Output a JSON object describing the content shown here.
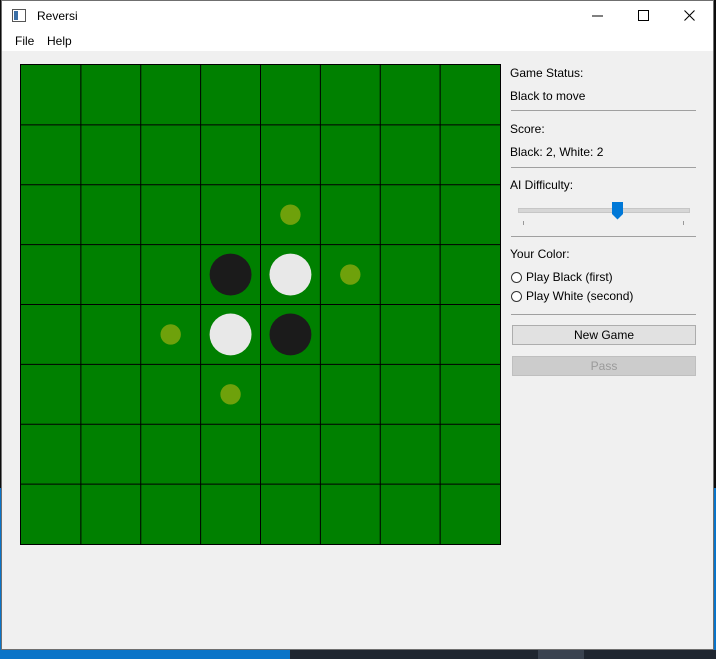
{
  "window": {
    "title": "Reversi",
    "controls": [
      "minimize",
      "maximize",
      "close"
    ]
  },
  "menu": {
    "items": [
      "File",
      "Help"
    ]
  },
  "board": {
    "size": 8,
    "colors": {
      "board": "#008000",
      "grid": "#000000",
      "black_piece": "#1b1b1b",
      "white_piece": "#e8e8e8",
      "hint": "#6ea10b"
    },
    "pieces": [
      {
        "row": 3,
        "col": 3,
        "color": "black"
      },
      {
        "row": 3,
        "col": 4,
        "color": "white"
      },
      {
        "row": 4,
        "col": 3,
        "color": "white"
      },
      {
        "row": 4,
        "col": 4,
        "color": "black"
      }
    ],
    "valid_moves": [
      {
        "row": 2,
        "col": 4
      },
      {
        "row": 3,
        "col": 5
      },
      {
        "row": 4,
        "col": 2
      },
      {
        "row": 5,
        "col": 3
      }
    ]
  },
  "panel": {
    "status_label": "Game Status:",
    "status_value": "Black to move",
    "score_label": "Score:",
    "score_value": "Black: 2, White: 2",
    "difficulty_label": "AI Difficulty:",
    "difficulty_level_fraction": 0.59,
    "color_label": "Your Color:",
    "radio_black": "Play Black (first)",
    "radio_white": "Play White (second)",
    "new_game": "New Game",
    "pass": "Pass",
    "accent_color": "#0078d7"
  }
}
